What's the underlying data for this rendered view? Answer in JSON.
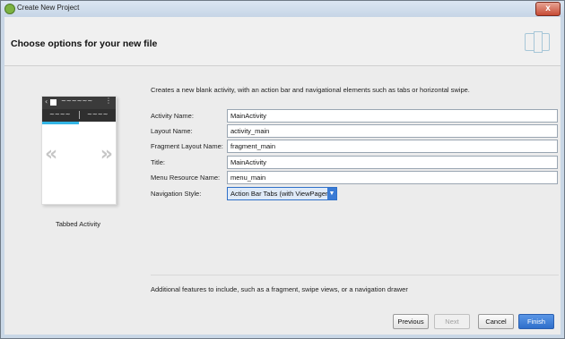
{
  "window": {
    "title": "Create New Project",
    "close_label": "x"
  },
  "header": {
    "title": "Choose options for your new file"
  },
  "preview": {
    "caption": "Tabbed Activity",
    "left_arrow": "«",
    "right_arrow": "»",
    "tab1": "~~~~",
    "tab2": "~~~~",
    "bar_title": "~~~~~~"
  },
  "description": "Creates a new blank activity, with an action bar and navigational elements such as tabs or horizontal swipe.",
  "fields": [
    {
      "label": "Activity Name:",
      "value": "MainActivity"
    },
    {
      "label": "Layout Name:",
      "value": "activity_main"
    },
    {
      "label": "Fragment Layout Name:",
      "value": "fragment_main"
    },
    {
      "label": "Title:",
      "value": "MainActivity"
    },
    {
      "label": "Menu Resource Name:",
      "value": "menu_main"
    }
  ],
  "navigation": {
    "label": "Navigation Style:",
    "value": "Action Bar Tabs (with ViewPager)"
  },
  "additional_text": "Additional features to include, such as a fragment, swipe views, or a navigation drawer",
  "buttons": {
    "previous": "Previous",
    "next": "Next",
    "cancel": "Cancel",
    "finish": "Finish"
  }
}
